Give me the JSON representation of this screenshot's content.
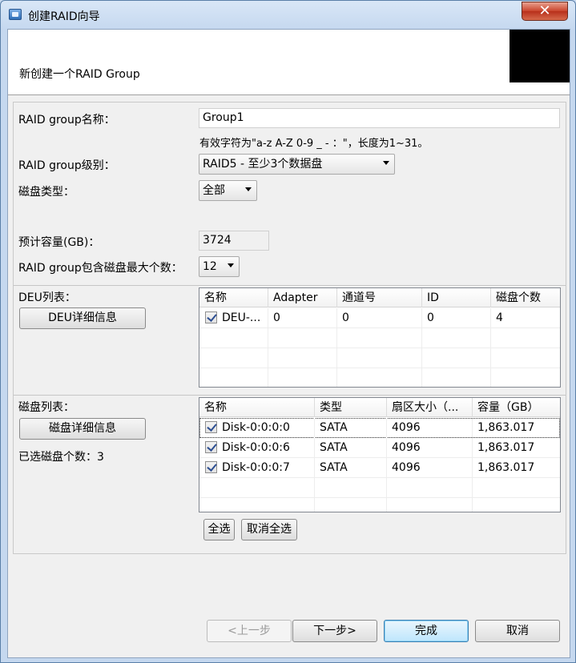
{
  "window": {
    "title": "创建RAID向导",
    "close_glyph": "✕"
  },
  "header": {
    "title": "新创建一个RAID Group"
  },
  "form": {
    "name_label": "RAID group名称：",
    "name_value": "Group1",
    "name_hint": "有效字符为\"a-z A-Z 0-9 _ - ：\"，长度为1~31。",
    "level_label": "RAID group级别：",
    "level_value": "RAID5  - 至少3个数据盘",
    "disk_type_label": "磁盘类型：",
    "disk_type_value": "全部",
    "capacity_label": "预计容量(GB)：",
    "capacity_value": "3724",
    "max_disks_label": "RAID group包含磁盘最大个数：",
    "max_disks_value": "12"
  },
  "deu": {
    "label": "DEU列表：",
    "detail_button": "DEU详细信息",
    "columns": [
      "名称",
      "Adapter",
      "通道号",
      "ID",
      "磁盘个数"
    ],
    "rows": [
      {
        "checked": true,
        "name": "DEU-...",
        "adapter": "0",
        "channel": "0",
        "id": "0",
        "disk_count": "4"
      }
    ]
  },
  "disks": {
    "label": "磁盘列表：",
    "detail_button": "磁盘详细信息",
    "selected_count_text": "已选磁盘个数：3",
    "columns": [
      "名称",
      "类型",
      "扇区大小（...",
      "容量（GB）"
    ],
    "rows": [
      {
        "checked": true,
        "name": "Disk-0:0:0:0",
        "type": "SATA",
        "sector": "4096",
        "capacity": "1,863.017"
      },
      {
        "checked": true,
        "name": "Disk-0:0:0:6",
        "type": "SATA",
        "sector": "4096",
        "capacity": "1,863.017"
      },
      {
        "checked": true,
        "name": "Disk-0:0:0:7",
        "type": "SATA",
        "sector": "4096",
        "capacity": "1,863.017"
      }
    ],
    "select_all": "全选",
    "deselect_all": "取消全选"
  },
  "footer": {
    "prev": "<上一步",
    "next": "下一步>",
    "finish": "完成",
    "cancel": "取消"
  }
}
